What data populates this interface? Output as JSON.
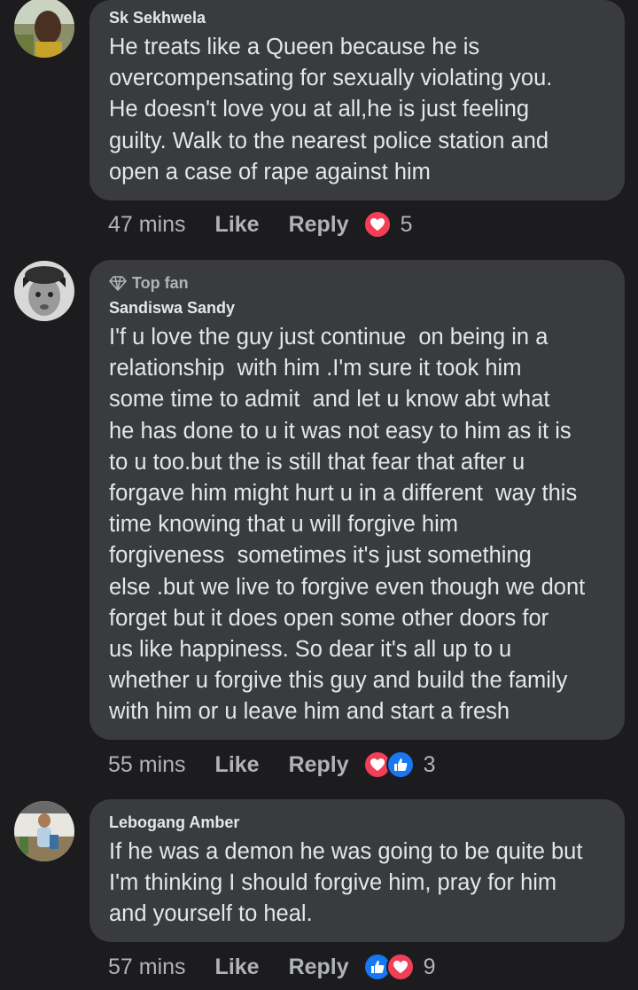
{
  "comments": [
    {
      "author": "Sk Sekhwela",
      "badge": "",
      "text": "He treats like a Queen because he is\novercompensating for sexually violating you.\nHe doesn't love you at all,he is just feeling\nguilty. Walk to the nearest police station and\nopen a case of rape against him",
      "time": "47 mins",
      "like_label": "Like",
      "reply_label": "Reply",
      "reactions": [
        "heart-icon"
      ],
      "reaction_count": "5"
    },
    {
      "author": "Sandiswa Sandy",
      "badge": "Top fan",
      "text": "I'f u love the guy just continue  on being in a\nrelationship  with him .I'm sure it took him\nsome time to admit  and let u know abt what\nhe has done to u it was not easy to him as it is\nto u too.but the is still that fear that after u\nforgave him might hurt u in a different  way this\ntime knowing that u will forgive him\nforgiveness  sometimes it's just something\nelse .but we live to forgive even though we dont\nforget but it does open some other doors for\nus like happiness. So dear it's all up to u\nwhether u forgive this guy and build the family\nwith him or u leave him and start a fresh",
      "time": "55 mins",
      "like_label": "Like",
      "reply_label": "Reply",
      "reactions": [
        "heart-icon",
        "thumbs-up-icon"
      ],
      "reaction_count": "3"
    },
    {
      "author": "Lebogang Amber",
      "badge": "",
      "text": "If he was a demon he was going to be quite but\nI'm thinking I should forgive him, pray for him\nand yourself to heal.",
      "time": "57 mins",
      "like_label": "Like",
      "reply_label": "Reply",
      "reactions": [
        "thumbs-up-icon",
        "heart-icon"
      ],
      "reaction_count": "9"
    }
  ],
  "colors": {
    "background": "#1c1c1e",
    "bubble": "#3a3b3c",
    "text": "#e4e6eb",
    "secondary": "#b0b3b8",
    "heart": "#f33e58",
    "like": "#1877f2"
  }
}
